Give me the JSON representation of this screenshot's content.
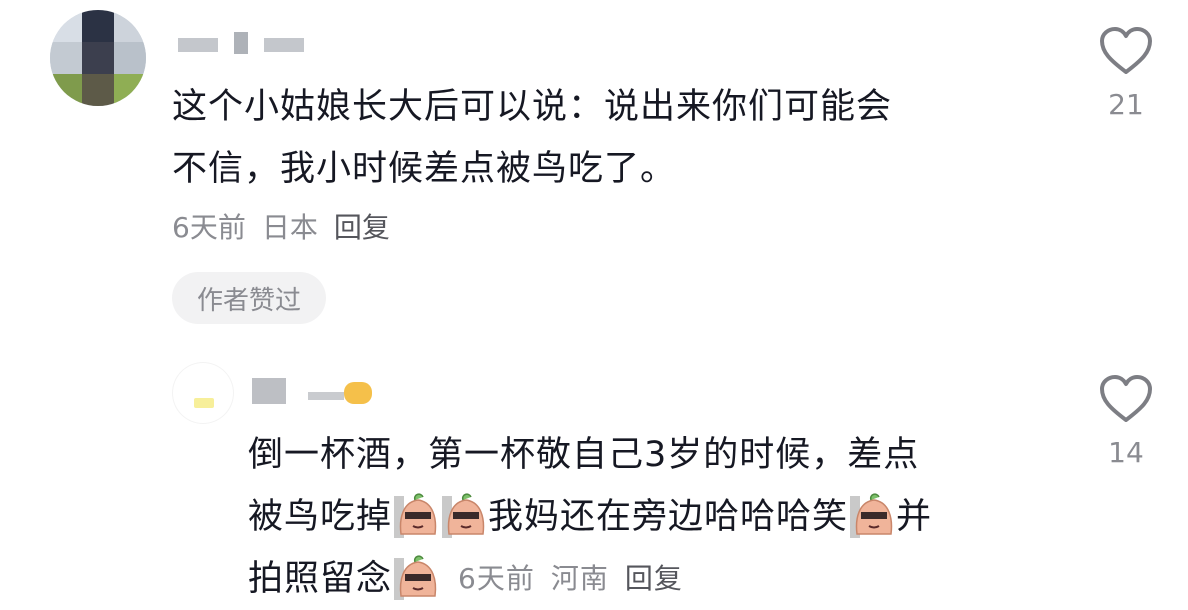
{
  "comment": {
    "text_line1": "这个小姑娘长大后可以说：说出来你们可能会",
    "text_line2": "不信，我小时候差点被鸟吃了。",
    "time": "6天前",
    "location": "日本",
    "reply_label": "回复",
    "badge": "作者赞过",
    "like_count": "21"
  },
  "reply": {
    "line1": "倒一杯酒，第一杯敬自己3岁的时候，差点",
    "line2_a": "被鸟吃掉",
    "line2_b": "我妈还在旁边哈哈哈笑",
    "line2_c": "并",
    "line3_a": "拍照留念",
    "time": "6天前",
    "location": "河南",
    "reply_label": "回复",
    "like_count": "14"
  },
  "icons": {
    "like": "heart-outline-icon",
    "sticker": "peanut-sunglasses-emoji"
  },
  "colors": {
    "text": "#161823",
    "meta": "#8a8b91",
    "badge_bg": "#f2f2f3"
  }
}
